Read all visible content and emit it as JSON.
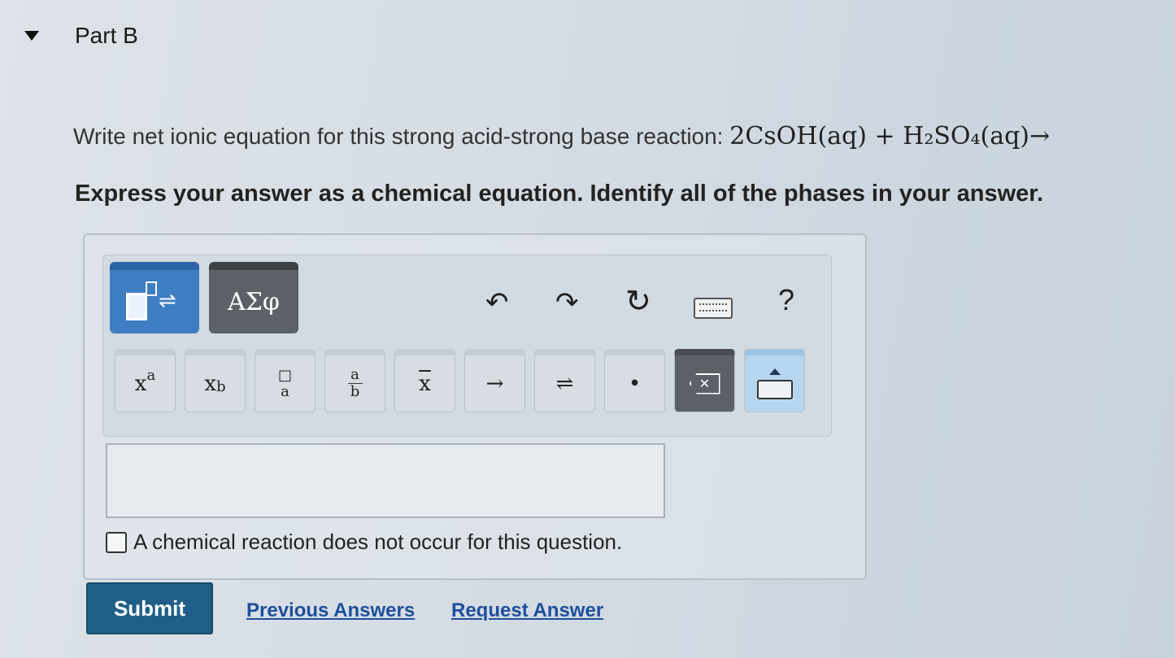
{
  "part": {
    "title": "Part B"
  },
  "question": {
    "prompt": "Write net ionic equation for this strong acid-strong base reaction:",
    "equation": "2CsOH(aq) + H₂SO₄(aq)→",
    "instruction": "Express your answer as a chemical equation. Identify all of the phases in your answer."
  },
  "toolbar": {
    "greek_label": "ΑΣφ",
    "undo_icon": "↶",
    "redo_icon": "↷",
    "reset_icon": "↻",
    "help_label": "?"
  },
  "keys": {
    "superscript": {
      "base": "x",
      "exp": "a"
    },
    "subscript": {
      "base": "x",
      "sub": "b"
    },
    "fraction": {
      "num": "a",
      "den": "b"
    },
    "overline": "x",
    "arrow": "→",
    "equilibrium": "⇌",
    "dot": "•",
    "backspace": "✕"
  },
  "answer": {
    "value": ""
  },
  "no_reaction_label": "A chemical reaction does not occur for this question.",
  "actions": {
    "submit": "Submit",
    "previous_answers": "Previous Answers",
    "request_answer": "Request Answer"
  },
  "colors": {
    "submit": "#1f5f87",
    "link": "#1d4f9b",
    "templates_mode": "#3f7ec2",
    "greek_mode": "#5c6168"
  }
}
